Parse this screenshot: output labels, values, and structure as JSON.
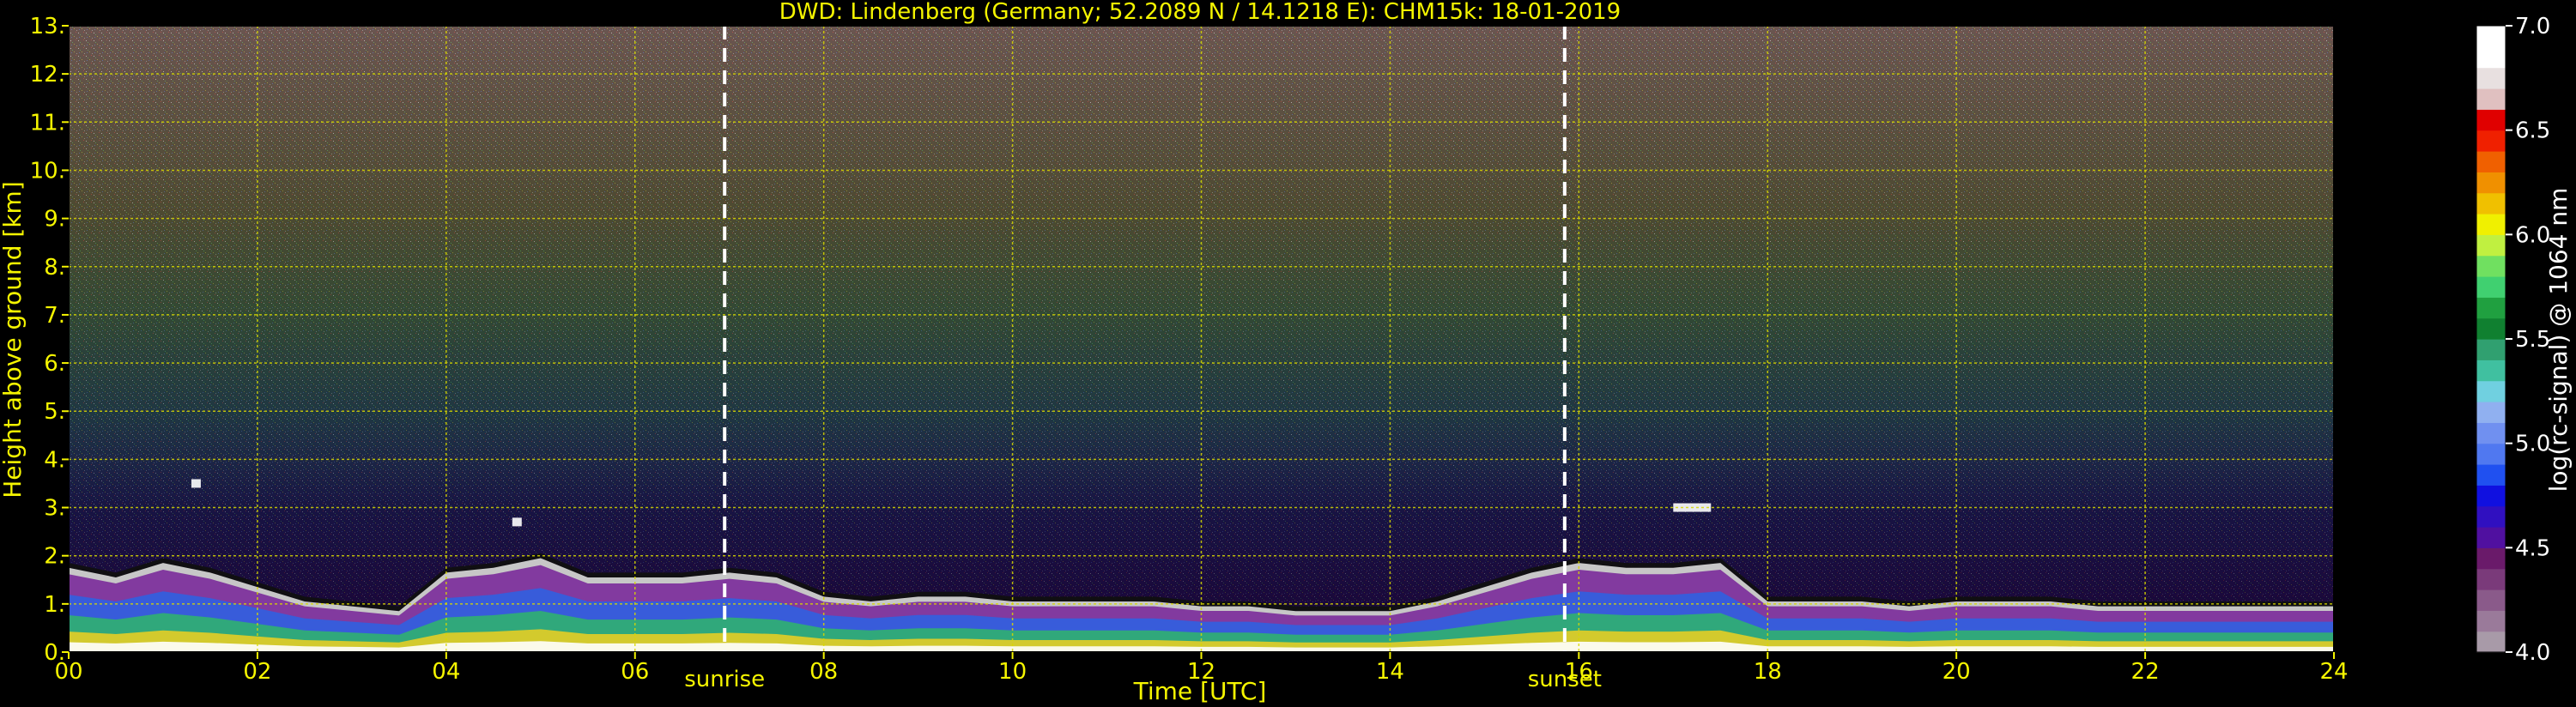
{
  "chart_data": {
    "type": "heatmap",
    "title": "DWD: Lindenberg (Germany; 52.2089 N / 14.1218 E):    CHM15k: 18-01-2019",
    "xlabel": "Time [UTC]",
    "ylabel": "Height above ground [km]",
    "xlim": [
      0,
      24
    ],
    "ylim": [
      0,
      13
    ],
    "x_ticks": [
      0,
      2,
      4,
      6,
      8,
      10,
      12,
      14,
      16,
      18,
      20,
      22,
      24
    ],
    "x_tick_labels": [
      "00",
      "02",
      "04",
      "06",
      "08",
      "10",
      "12",
      "14",
      "16",
      "18",
      "20",
      "22",
      "24"
    ],
    "y_ticks": [
      0,
      1,
      2,
      3,
      4,
      5,
      6,
      7,
      8,
      9,
      10,
      11,
      12,
      13
    ],
    "y_tick_labels": [
      "0.",
      "1.",
      "2.",
      "3.",
      "4.",
      "5.",
      "6.",
      "7.",
      "8.",
      "9.",
      "10.",
      "11.",
      "12.",
      "13."
    ],
    "grid": true,
    "annotations": [
      {
        "label": "sunrise",
        "x": 6.95
      },
      {
        "label": "sunset",
        "x": 15.85
      }
    ],
    "colorbar": {
      "label": "log(rc-signal) @ 1064 nm",
      "range": [
        4.0,
        7.0
      ],
      "ticks": [
        4.0,
        4.5,
        5.0,
        5.5,
        6.0,
        6.5,
        7.0
      ],
      "tick_labels": [
        "4.0",
        "4.5",
        "5.0",
        "5.5",
        "6.0",
        "6.5",
        "7.0"
      ],
      "colors": [
        "#a89aa8",
        "#9a7a9a",
        "#8a5a8a",
        "#7a3a7a",
        "#6a1a6a",
        "#5010a0",
        "#3010c0",
        "#1010e0",
        "#2050f0",
        "#5078f0",
        "#7090f0",
        "#90b0f0",
        "#70d0e0",
        "#40c0a0",
        "#30a070",
        "#108030",
        "#20a040",
        "#40d070",
        "#70e060",
        "#c0f040",
        "#f0f000",
        "#f0c000",
        "#f09000",
        "#f06000",
        "#f02000",
        "#e00000",
        "#e0c0c0",
        "#e8e0e0",
        "#ffffff",
        "#ffffff"
      ]
    },
    "boundary_layer": {
      "x": [
        0,
        0.5,
        1,
        1.5,
        2,
        2.5,
        3,
        3.5,
        4,
        4.5,
        5,
        5.5,
        6,
        6.5,
        7,
        7.5,
        8,
        8.5,
        9,
        9.5,
        10,
        10.5,
        11,
        11.5,
        12,
        12.5,
        13,
        13.5,
        14,
        14.5,
        15,
        15.5,
        16,
        16.5,
        17,
        17.5,
        18,
        18.5,
        19,
        19.5,
        20,
        20.5,
        21,
        21.5,
        22,
        22.5,
        23,
        23.5,
        24
      ],
      "top_km": [
        1.7,
        1.5,
        1.8,
        1.6,
        1.3,
        1.0,
        0.9,
        0.8,
        1.6,
        1.7,
        1.9,
        1.5,
        1.5,
        1.5,
        1.6,
        1.5,
        1.1,
        1.0,
        1.1,
        1.1,
        1.0,
        1.0,
        1.0,
        1.0,
        0.9,
        0.9,
        0.8,
        0.8,
        0.8,
        1.0,
        1.3,
        1.6,
        1.8,
        1.7,
        1.7,
        1.8,
        1.0,
        1.0,
        1.0,
        0.9,
        1.0,
        1.0,
        1.0,
        0.9,
        0.9,
        0.9,
        0.9,
        0.9,
        0.9
      ]
    },
    "cloud_patches": [
      {
        "x": [
          1.3,
          1.4
        ],
        "y_km": 3.5
      },
      {
        "x": [
          17.0,
          17.4
        ],
        "y_km": 3.0
      },
      {
        "x": [
          4.7,
          4.8
        ],
        "y_km": 2.7
      }
    ]
  }
}
